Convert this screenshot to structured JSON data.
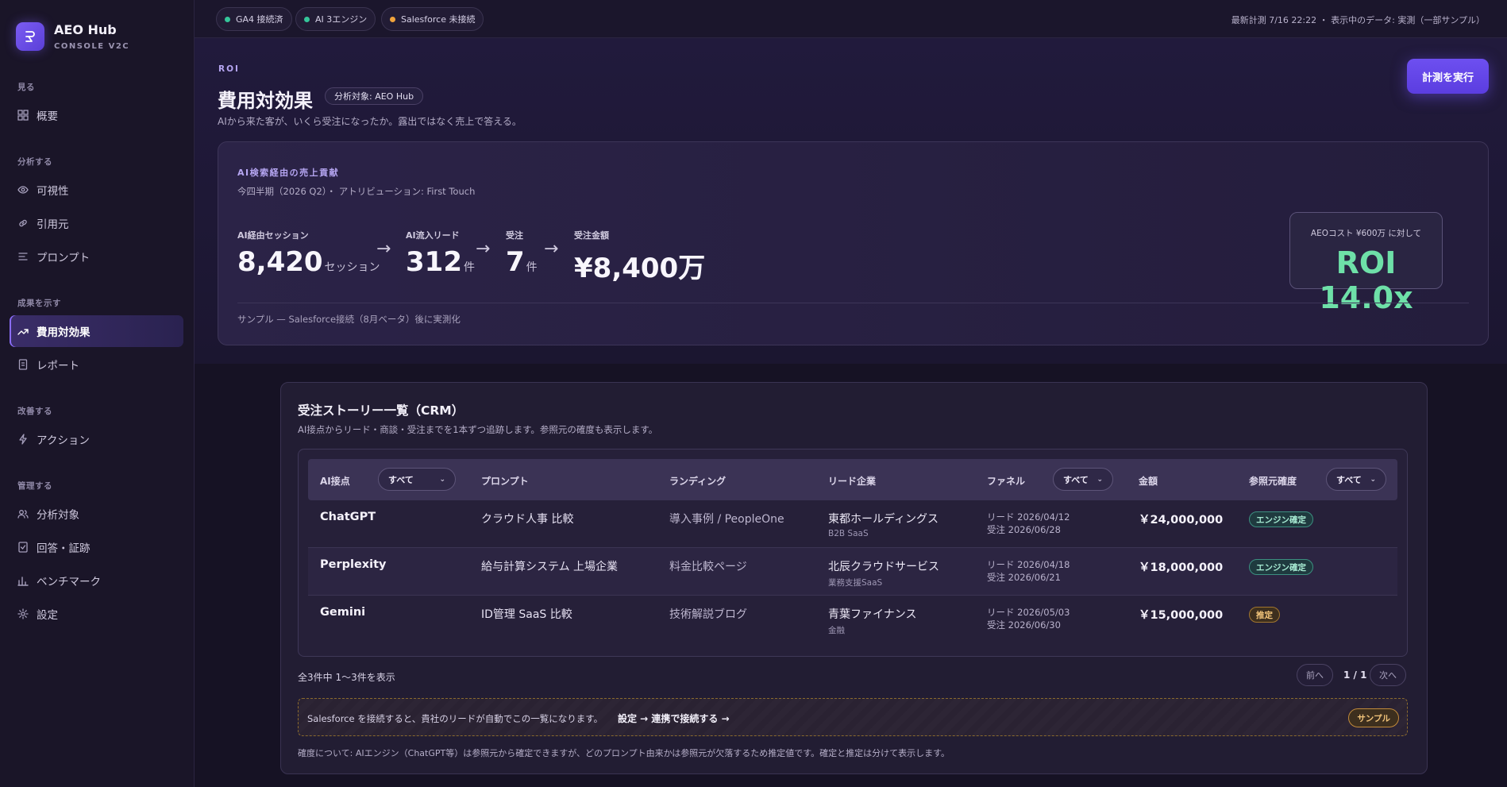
{
  "sidebar": {
    "brand_name": "AEO Hub",
    "brand_sub": "CONSOLE V2C",
    "sections": {
      "view": "見る",
      "analyze": "分析する",
      "results": "成果を示す",
      "improve": "改善する",
      "manage": "管理する"
    },
    "items": {
      "overview": "概要",
      "visibility": "可視性",
      "citations": "引用元",
      "prompts": "プロンプト",
      "roi": "費用対効果",
      "reports": "レポート",
      "actions": "アクション",
      "targets": "分析対象",
      "answers": "回答・証跡",
      "benchmark": "ベンチマーク",
      "settings": "設定"
    },
    "active": "roi"
  },
  "topbar": {
    "pills": [
      {
        "label": "GA4 接続済",
        "color": "#35c59a"
      },
      {
        "label": "AI 3エンジン",
        "color": "#35c59a"
      },
      {
        "label": "Salesforce 未接続",
        "color": "#f0a33c"
      }
    ],
    "meta": "最新計測 7/16 22:22 ・ 表示中のデータ: 実測（一部サンプル）"
  },
  "header": {
    "eyebrow": "ROI",
    "title": "費用対効果",
    "target_chip": "分析対象: AEO Hub",
    "description": "AIから来た客が、いくら受注になったか。露出ではなく売上で答える。",
    "run_button": "計測を実行"
  },
  "revenue": {
    "label": "AI検索経由の売上貢献",
    "subtitle": "今四半期（2026 Q2）・ アトリビューション: First Touch",
    "metrics": [
      {
        "label": "AI経由セッション",
        "value": "8,420",
        "unit": "セッション"
      },
      {
        "label": "AI流入リード",
        "value": "312",
        "unit": "件"
      },
      {
        "label": "受注",
        "value": "7",
        "unit": "件"
      },
      {
        "label": "受注金額",
        "value": "¥8,400万",
        "unit": ""
      }
    ],
    "arrow": "→",
    "roi_label": "AEOコスト ¥600万 に対して",
    "roi_value": "ROI 14.0x",
    "note": "サンプル — Salesforce接続（8月ベータ）後に実測化"
  },
  "crm": {
    "title": "受注ストーリー一覧（CRM）",
    "description": "AI接点からリード・商談・受注までを1本ずつ追跡します。参照元の確度も表示します。",
    "columns": {
      "engine": "AI接点",
      "prompt": "プロンプト",
      "landing": "ランディング",
      "company": "リード企業",
      "funnel": "ファネル",
      "amount": "金額",
      "confidence": "参照元確度"
    },
    "filters": {
      "engine": "すべて",
      "funnel": "すべて",
      "confidence": "すべて"
    },
    "rows": [
      {
        "engine": "ChatGPT",
        "prompt": "クラウド人事 比較",
        "landing": "導入事例 / PeopleOne",
        "company": "東都ホールディングス",
        "industry": "B2B SaaS",
        "lead": "リード 2026/04/12",
        "won": "受注 2026/06/28",
        "amount": "￥24,000,000",
        "badge": "エンジン確定",
        "badge_type": "green"
      },
      {
        "engine": "Perplexity",
        "prompt": "給与計算システム 上場企業",
        "landing": "料金比較ページ",
        "company": "北辰クラウドサービス",
        "industry": "業務支援SaaS",
        "lead": "リード 2026/04/18",
        "won": "受注 2026/06/21",
        "amount": "￥18,000,000",
        "badge": "エンジン確定",
        "badge_type": "green"
      },
      {
        "engine": "Gemini",
        "prompt": "ID管理 SaaS 比較",
        "landing": "技術解説ブログ",
        "company": "青葉ファイナンス",
        "industry": "金融",
        "lead": "リード 2026/05/03",
        "won": "受注 2026/06/30",
        "amount": "￥15,000,000",
        "badge": "推定",
        "badge_type": "orange"
      }
    ],
    "count_text": "全3件中 1〜3件を表示",
    "pager": {
      "prev": "前へ",
      "page": "1 / 1",
      "next": "次へ"
    },
    "banner": {
      "text": "Salesforce を接続すると、貴社のリードが自動でこの一覧になります。",
      "link": "設定 → 連携で接続する →",
      "badge": "サンプル"
    },
    "footnote": "確度について: AIエンジン（ChatGPT等）は参照元から確定できますが、どのプロンプト由来かは参照元が欠落するため推定値です。確定と推定は分けて表示します。"
  }
}
